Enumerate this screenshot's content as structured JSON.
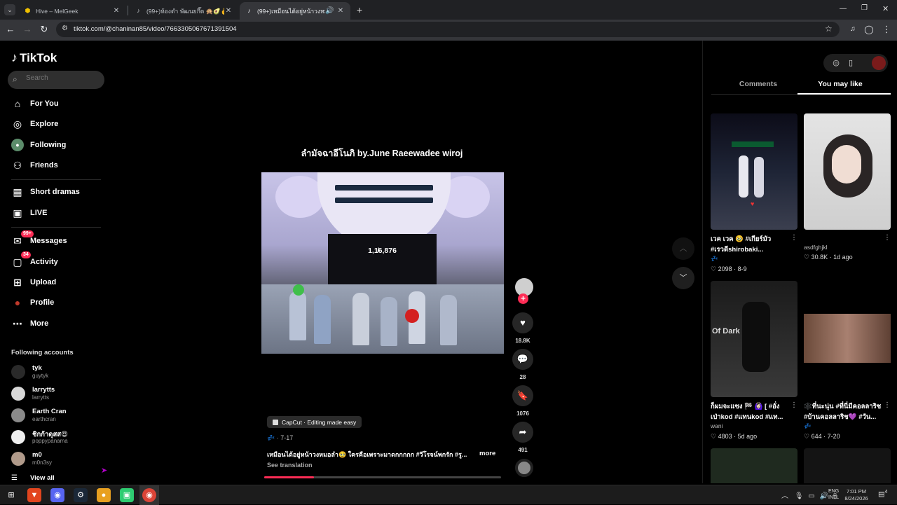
{
  "browser": {
    "tabs": [
      {
        "title": "Hive – MelGeek",
        "icon": "hive-icon"
      },
      {
        "title": "(99+)ห้องดำ พัฒนยกึ๊ด 🙊🥑✌️🔮 🎯",
        "icon": "tiktok-icon"
      },
      {
        "title": "(99+)เหมือนได้อยู่หน้าวงหมอลำ 🥹",
        "icon": "tiktok-icon",
        "active": true
      }
    ],
    "url": "tiktok.com/@chaninan85/video/7663305067671391504"
  },
  "sidebar": {
    "logo": "TikTok",
    "search_placeholder": "Search",
    "nav": [
      {
        "label": "For You",
        "icon": "home-icon"
      },
      {
        "label": "Explore",
        "icon": "compass-icon"
      },
      {
        "label": "Following",
        "icon": "following-avatar-icon"
      },
      {
        "label": "Friends",
        "icon": "friends-icon"
      },
      {
        "label": "Short dramas",
        "icon": "short-dramas-icon"
      },
      {
        "label": "LIVE",
        "icon": "live-icon"
      },
      {
        "label": "Messages",
        "icon": "messages-icon",
        "badge": "99+"
      },
      {
        "label": "Activity",
        "icon": "activity-icon",
        "badge": "34"
      },
      {
        "label": "Upload",
        "icon": "upload-icon"
      },
      {
        "label": "Profile",
        "icon": "profile-avatar-icon"
      },
      {
        "label": "More",
        "icon": "more-icon"
      }
    ],
    "following_title": "Following accounts",
    "accounts": [
      {
        "name": "tyk",
        "username": "guytyk"
      },
      {
        "name": "larrytts",
        "username": "larrytts"
      },
      {
        "name": "Earth Cran",
        "username": "earthcran"
      },
      {
        "name": "ชิกก้าดุสส😍",
        "username": "poppypanama"
      },
      {
        "name": "m0",
        "username": "m0n3sy"
      }
    ],
    "view_all": "View all"
  },
  "video": {
    "title": "ลำมัจฉาอีโนภิ by.June Raeewadee wiroj",
    "counter_text": "1,1̸6,876",
    "capcut_label": "CapCut · Editing made easy",
    "date": "· 7-17",
    "caption": "เหมือนได้อยู่หน้าวงหมอลำ🥹 ใครคือเพราะมาดกกกกก #วีโรจน์พกรัก #รู...",
    "more_label": "more",
    "see_translation": "See translation",
    "progress": 0.21,
    "likes": "18.8K",
    "comments": "28",
    "saves": "1076",
    "shares": "491"
  },
  "right_panel": {
    "tabs": [
      "Comments",
      "You may like"
    ],
    "active_tab": "You may like",
    "cards": [
      {
        "title": "เวค เวค 🥹 #เกียร์มัว #เรวดีshirobaki...",
        "sub": "💤",
        "likes": "2098",
        "date": "8-9"
      },
      {
        "title": "",
        "sub": "asdfghjkl",
        "likes": "30.8K",
        "date": "1d ago"
      },
      {
        "title": "ก็ผมจะแซง 🏁 🙆🏻‍♀️ [ #อั่ง เป่าkod #แทนkod #แท...",
        "sub": "wani",
        "likes": "4803",
        "date": "5d ago"
      },
      {
        "title": "🕸️ที่นะนุ่น #ที่นี่มีคอลลาริช #บ้านคอลลาริช💜 #วัน...",
        "sub": "💤",
        "likes": "644",
        "date": "7-20"
      }
    ]
  },
  "taskbar": {
    "lang_top": "ENG",
    "lang_bottom": "INTL",
    "time": "7:01 PM",
    "date": "8/24/2026",
    "notif_count": "4"
  },
  "colors": {
    "accent": "#fe2c55",
    "background": "#000000",
    "chrome": "#35363a"
  }
}
